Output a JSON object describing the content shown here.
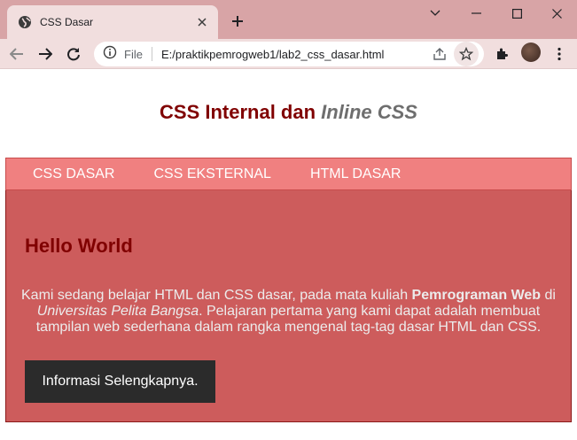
{
  "browser": {
    "tab_title": "CSS Dasar",
    "address_scheme_label": "File",
    "address_url": "E:/praktikpemrogweb1/lab2_css_dasar.html"
  },
  "page": {
    "title_part1": "CSS Internal dan ",
    "title_part2": "Inline CSS",
    "nav": [
      "CSS DASAR",
      "CSS EKSTERNAL",
      "HTML DASAR"
    ],
    "heading": "Hello World",
    "paragraph": {
      "text1": "Kami sedang belajar HTML dan CSS dasar, pada mata kuliah ",
      "bold": "Pemrograman Web",
      "text2": " di ",
      "italic": "Universitas Pelita Bangsa",
      "text3": ". Pelajaran pertama yang kami dapat adalah membuat tampilan web sederhana dalam rangka mengenal tag-tag dasar HTML dan CSS."
    },
    "button_label": "Informasi Selengkapnya."
  },
  "colors": {
    "title": "#800000",
    "nav_background": "#f08080",
    "main_background": "#cd5c5c",
    "button_background": "#2b2b2b"
  },
  "icons": [
    "globe-icon",
    "close-icon",
    "plus-icon",
    "chevron-down-icon",
    "minimize-icon",
    "maximize-icon",
    "window-close-icon",
    "back-arrow-icon",
    "forward-arrow-icon",
    "reload-icon",
    "info-icon",
    "share-icon",
    "star-icon",
    "extensions-icon",
    "kebab-menu-icon"
  ]
}
